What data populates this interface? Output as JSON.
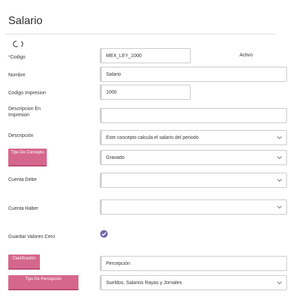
{
  "page": {
    "title": "Salario"
  },
  "form": {
    "codigo": {
      "label": "Codigo",
      "required_mark": "*",
      "value": "MEX_LEY_1000",
      "status": "Activo"
    },
    "nombre": {
      "label": "Nombre",
      "value": "Salario"
    },
    "codigo_impresion": {
      "label": "Codigo Impresion",
      "value": "1000"
    },
    "descripcion_impresion": {
      "label_line1": "Descripcion En",
      "label_line2": "Impresion",
      "value": ""
    },
    "descripcion": {
      "label": "Descripción",
      "value": "Este concepto calcula el salario del periodo"
    },
    "tipo_concepto": {
      "label": "Tipo De Concepto",
      "value": "Gravado"
    },
    "cuenta_debe": {
      "label": "Cuenta Debe",
      "value": ""
    },
    "cuenta_haber": {
      "label": "Cuenta Haber",
      "value": ""
    },
    "guardar_valores_cero": {
      "label": "Guardar Valores Cero",
      "checked": true
    },
    "clasificacion": {
      "label": "Clasificación",
      "value": "Percepción"
    },
    "tipo_percepcion": {
      "label": "Tipo De Percepción",
      "value": "Sueldos, Salarios  Rayas y Jornales"
    }
  },
  "colors": {
    "accent": "#d6678c",
    "accent_dark": "#b84a71",
    "check": "#6f6aa8",
    "border": "#c9c9c9"
  }
}
